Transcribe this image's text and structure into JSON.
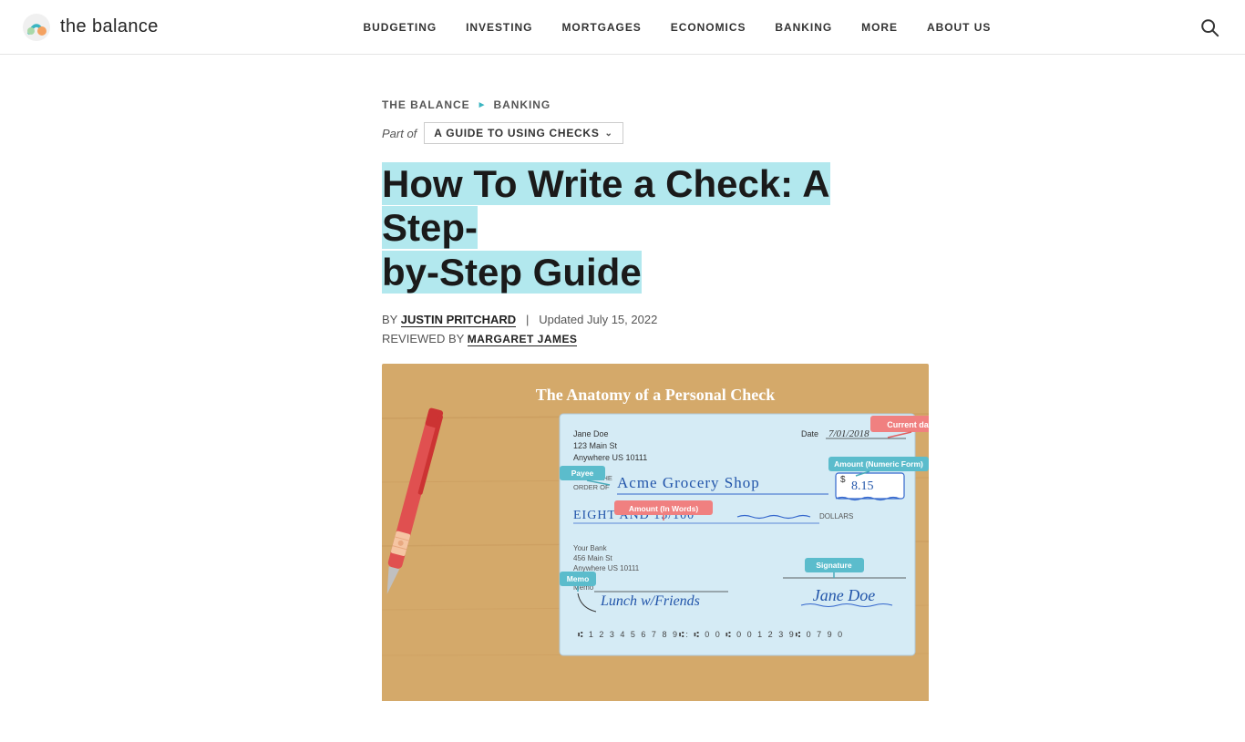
{
  "header": {
    "logo_text": "the balance",
    "nav_items": [
      {
        "label": "BUDGETING",
        "href": "#"
      },
      {
        "label": "INVESTING",
        "href": "#"
      },
      {
        "label": "MORTGAGES",
        "href": "#"
      },
      {
        "label": "ECONOMICS",
        "href": "#"
      },
      {
        "label": "BANKING",
        "href": "#"
      },
      {
        "label": "MORE",
        "href": "#"
      },
      {
        "label": "ABOUT US",
        "href": "#"
      }
    ]
  },
  "breadcrumb": {
    "items": [
      {
        "label": "THE BALANCE",
        "href": "#"
      },
      {
        "label": "BANKING",
        "href": "#"
      }
    ]
  },
  "part_of": {
    "label": "Part of",
    "dropdown_text": "A GUIDE TO USING CHECKS"
  },
  "article": {
    "title_line1": "How To Write a Check: A Step-",
    "title_line2": "by-Step Guide",
    "highlight_start": "How To Write a Check: A Step-",
    "by_label": "BY",
    "author_name": "JUSTIN PRITCHARD",
    "updated_label": "Updated July 15, 2022",
    "reviewed_label": "REVIEWED BY",
    "reviewer_name": "MARGARET JAMES"
  },
  "check_image": {
    "title": "The Anatomy of a Personal Check",
    "payee_name": "Jane Doe",
    "payee_address1": "123 Main St",
    "payee_address2": "Anywhere US 10111",
    "date_label": "Date",
    "date_value": "7/01/2018",
    "current_date_tag": "Current date",
    "payee_tag": "Payee",
    "pay_to_label": "PAY TO THE ORDER OF",
    "payee_value": "Acme Grocery Shop",
    "amount_numeric_tag": "Amount (Numeric Form)",
    "amount_symbol": "$",
    "amount_numeric": "8.15",
    "amount_words_tag": "Amount (In Words)",
    "amount_words": "EIGHT AND 15/100",
    "dollars_label": "DOLLARS",
    "bank_name": "Your Bank",
    "bank_address1": "456 Main St",
    "bank_address2": "Anywhere US 10111",
    "signature_tag": "Signature",
    "signature_value": "Jane Doe",
    "memo_tag": "Memo",
    "memo_value": "Lunch w/Friends",
    "routing_number": "⑆ 1 2 3 4 5 6 7 8 9⑆:  ⑆ 0 0 ⑆ 0 0 1 2 3 9⑆"
  },
  "colors": {
    "accent_teal": "#3ab5c1",
    "highlight_blue": "#b2e8ee",
    "check_bg": "#c8e8f0",
    "wood_bg": "#d4a96a",
    "tag_pink": "#f08080",
    "tag_teal": "#5bbccc"
  }
}
